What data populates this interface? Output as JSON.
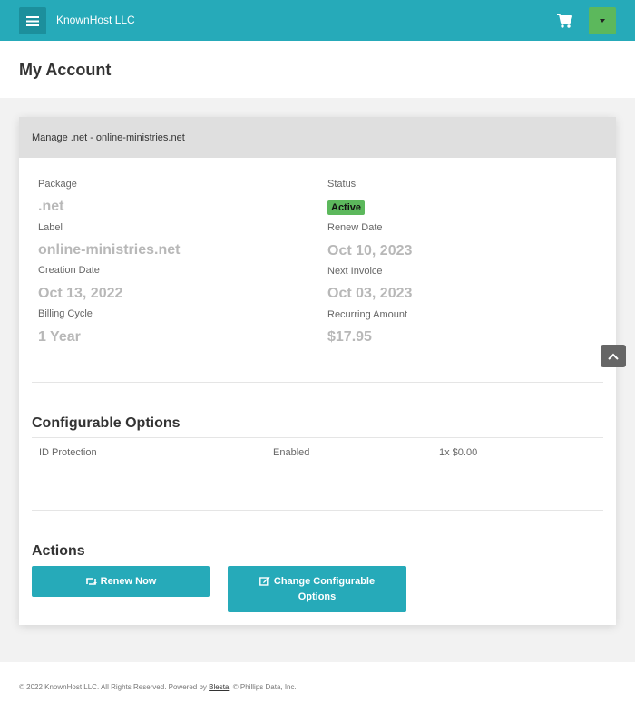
{
  "header": {
    "brand": "KnownHost LLC",
    "menu_icon": "hamburger-icon",
    "cart_icon": "cart-icon",
    "user_menu_icon": "caret-down-icon"
  },
  "page": {
    "title": "My Account"
  },
  "service": {
    "heading": "Manage .net - online-ministries.net",
    "left": {
      "package_label": "Package",
      "package_value": ".net",
      "label_label": "Label",
      "label_value": "online-ministries.net",
      "creation_label": "Creation Date",
      "creation_value": "Oct 13, 2022",
      "cycle_label": "Billing Cycle",
      "cycle_value": "1 Year"
    },
    "right": {
      "status_label": "Status",
      "status_value": "Active",
      "renew_label": "Renew Date",
      "renew_value": "Oct 10, 2023",
      "invoice_label": "Next Invoice",
      "invoice_value": "Oct 03, 2023",
      "amount_label": "Recurring Amount",
      "amount_value": "$17.95"
    }
  },
  "options": {
    "title": "Configurable Options",
    "rows": [
      {
        "name": "ID Protection",
        "value": "Enabled",
        "price": "1x $0.00"
      }
    ]
  },
  "actions": {
    "title": "Actions",
    "renew_label": "Renew Now",
    "change_label_line1": "Change Configurable",
    "change_label_line2": "Options"
  },
  "footer": {
    "prefix": "© 2022 KnownHost LLC. All Rights Reserved. Powered by ",
    "link": "Blesta",
    "suffix": ", © Phillips Data, Inc."
  },
  "colors": {
    "accent": "#26aab9",
    "status_active": "#5cb85c"
  }
}
